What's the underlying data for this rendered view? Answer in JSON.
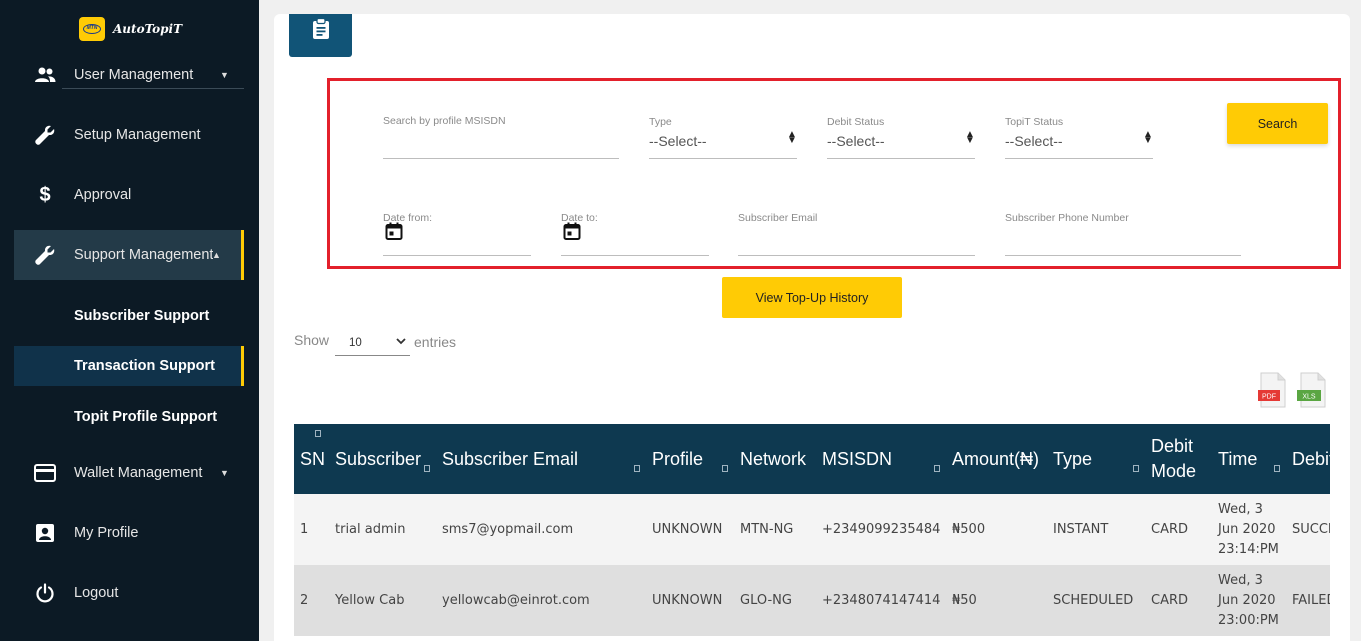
{
  "brand": {
    "name": "AutoTopiT",
    "logo_text": "MTN"
  },
  "sidebar": {
    "items": [
      {
        "label": "User Management",
        "icon": "users-icon",
        "has_caret": true
      },
      {
        "label": "Setup Management",
        "icon": "wrench-icon"
      },
      {
        "label": "Approval",
        "icon": "dollar-icon"
      },
      {
        "label": "Support Management",
        "icon": "wrench-icon",
        "active": true
      },
      {
        "label": "Wallet Management",
        "icon": "card-icon",
        "has_caret": true
      },
      {
        "label": "My Profile",
        "icon": "profile-icon"
      },
      {
        "label": "Logout",
        "icon": "power-icon"
      }
    ],
    "sub_items": [
      {
        "label": "Subscriber Support"
      },
      {
        "label": "Transaction Support",
        "active": true
      },
      {
        "label": "Topit Profile Support"
      }
    ]
  },
  "filters": {
    "msisdn_label": "Search by profile MSISDN",
    "type_label": "Type",
    "type_value": "--Select--",
    "debit_status_label": "Debit Status",
    "debit_status_value": "--Select--",
    "topit_status_label": "TopiT Status",
    "topit_status_value": "--Select--",
    "search_label": "Search",
    "date_from_label": "Date from:",
    "date_to_label": "Date to:",
    "email_label": "Subscriber Email",
    "phone_label": "Subscriber Phone Number"
  },
  "history_button": "View Top-Up History",
  "show": {
    "label": "Show",
    "value": "10",
    "suffix": "entries"
  },
  "exports": {
    "pdf": "PDF",
    "xls": "XLS"
  },
  "table": {
    "headers": [
      "SN",
      "Subscriber",
      "Subscriber Email",
      "Profile",
      "Network",
      "MSISDN",
      "Amount(₦)",
      "Type",
      "Debit Mode",
      "Time",
      "Debit Status"
    ],
    "rows": [
      {
        "sn": "1",
        "subscriber": "trial admin",
        "email": "sms7@yopmail.com",
        "profile": "UNKNOWN",
        "network": "MTN-NG",
        "msisdn": "+2349099235484",
        "amount": "₦500",
        "type": "INSTANT",
        "mode": "CARD",
        "time_1": "Wed, 3",
        "time_2": "Jun 2020",
        "time_3": "23:14:PM",
        "status": "SUCCESS"
      },
      {
        "sn": "2",
        "subscriber": "Yellow Cab",
        "email": "yellowcab@einrot.com",
        "profile": "UNKNOWN",
        "network": "GLO-NG",
        "msisdn": "+2348074147414",
        "amount": "₦50",
        "type": "SCHEDULED",
        "mode": "CARD",
        "time_1": "Wed, 3",
        "time_2": "Jun 2020",
        "time_3": "23:00:PM",
        "status": "FAILED"
      }
    ]
  },
  "colors": {
    "sidebar_bg": "#0c1a25",
    "accent": "#ffcb05",
    "header_bg": "#0e3950",
    "highlight": "#e3202b"
  }
}
